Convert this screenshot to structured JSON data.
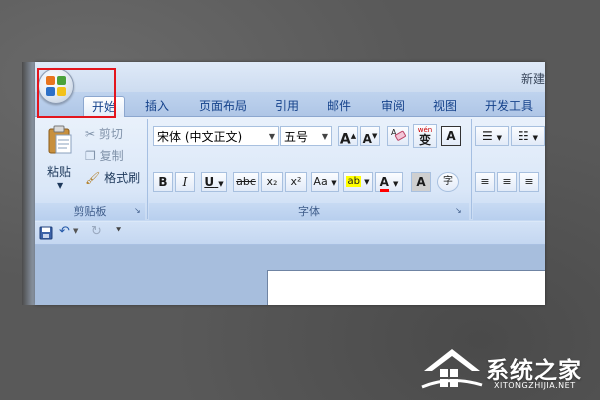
{
  "window": {
    "title": "新建"
  },
  "tabs": [
    "开始",
    "插入",
    "页面布局",
    "引用",
    "邮件",
    "审阅",
    "视图",
    "开发工具"
  ],
  "clipboard": {
    "paste_label": "粘贴",
    "cut_label": "剪切",
    "copy_label": "复制",
    "format_painter_label": "格式刷",
    "group_label": "剪贴板"
  },
  "font": {
    "font_name": "宋体 (中文正文)",
    "font_size": "五号",
    "group_label": "字体",
    "phonetic_glyph": "wén",
    "char_border_glyph": "A",
    "grow_glyph": "A",
    "shrink_glyph": "A",
    "bold": "B",
    "italic": "I",
    "underline": "U",
    "strike": "abc",
    "subscript": "x₂",
    "superscript": "x²",
    "case": "Aa",
    "highlight": "ab",
    "font_color": "A",
    "char_shading": "A",
    "enclose": "字"
  },
  "watermark": {
    "brand": "系统之家",
    "url": "XITONGZHIJIA.NET"
  },
  "colors": {
    "selection_box": "#e3151d",
    "ribbon_text": "#15428b",
    "highlight_yellow": "#ffff00",
    "font_color_red": "#ff0000"
  }
}
